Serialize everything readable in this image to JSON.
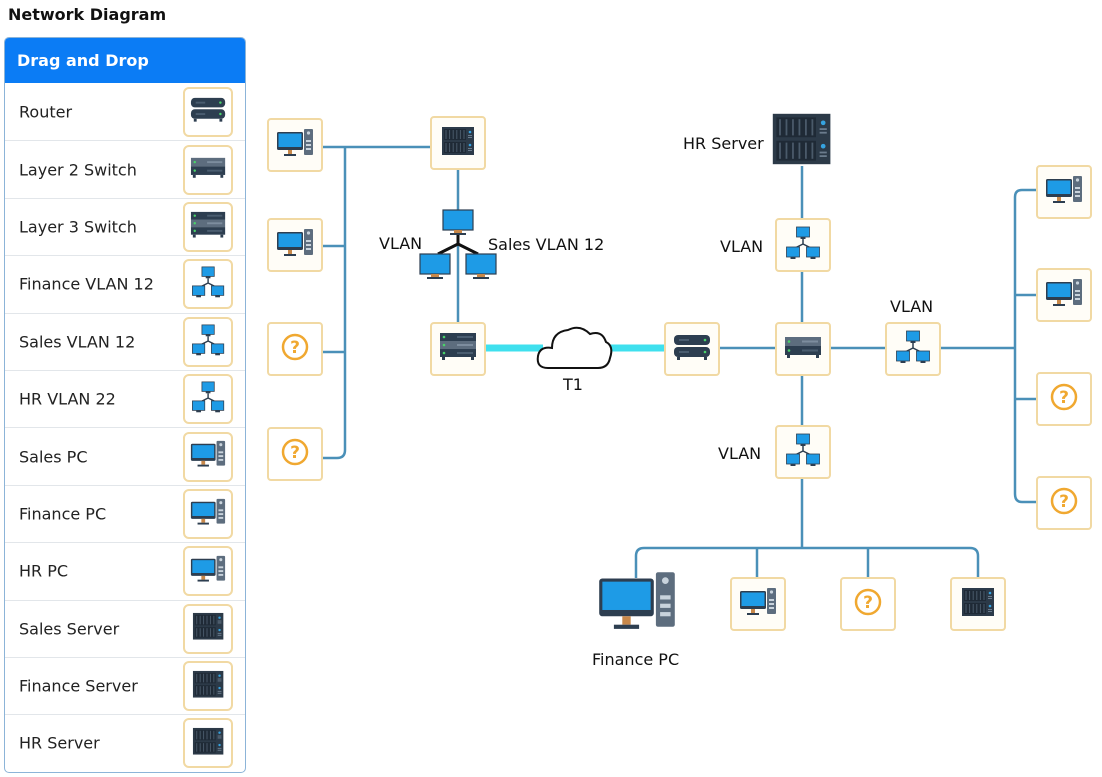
{
  "page": {
    "title": "Network Diagram"
  },
  "palette": {
    "header": "Drag and Drop",
    "items": [
      {
        "label": "Router",
        "icon": "router-icon"
      },
      {
        "label": "Layer 2 Switch",
        "icon": "layer2-switch-icon"
      },
      {
        "label": "Layer 3 Switch",
        "icon": "layer3-switch-icon"
      },
      {
        "label": "Finance VLAN 12",
        "icon": "vlan-icon"
      },
      {
        "label": "Sales VLAN 12",
        "icon": "vlan-icon"
      },
      {
        "label": "HR VLAN 22",
        "icon": "vlan-icon"
      },
      {
        "label": "Sales PC",
        "icon": "pc-icon"
      },
      {
        "label": "Finance PC",
        "icon": "pc-icon"
      },
      {
        "label": "HR PC",
        "icon": "pc-icon"
      },
      {
        "label": "Sales Server",
        "icon": "server-icon"
      },
      {
        "label": "Finance Server",
        "icon": "server-icon"
      },
      {
        "label": "HR Server",
        "icon": "server-icon"
      }
    ]
  },
  "diagram": {
    "labels": {
      "vlan_left": "VLAN",
      "sales_vlan": "Sales VLAN 12",
      "t1": "T1",
      "hr_server": "HR Server",
      "vlan_top": "VLAN",
      "vlan_right": "VLAN",
      "vlan_bottom": "VLAN",
      "finance_pc": "Finance PC"
    },
    "unknown_symbol": "?"
  },
  "colors": {
    "header_blue": "#0b7cf5",
    "wire": "#4a90b8",
    "t1_link": "#3fe0ee",
    "tile_border": "#f1d9a3",
    "question": "#f0a830"
  }
}
